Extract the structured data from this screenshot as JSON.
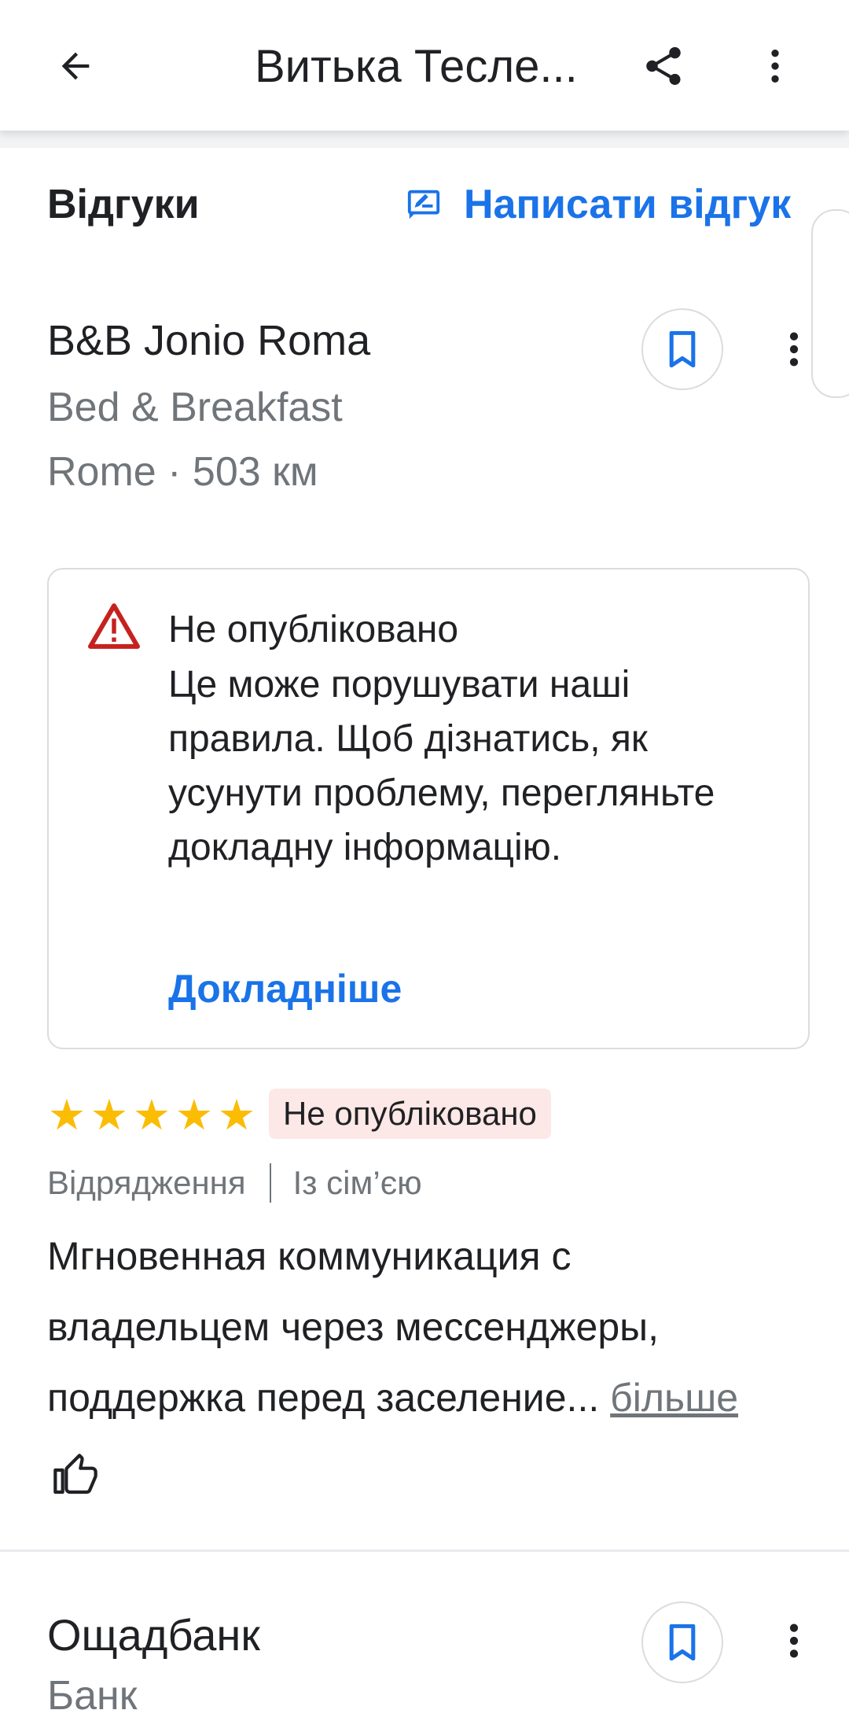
{
  "appbar": {
    "title": "Витька Теслe..."
  },
  "section": {
    "title": "Відгуки",
    "write_review_label": "Написати відгук"
  },
  "review": {
    "place_name": "B&B Jonio Roma",
    "place_type": "Bed & Breakfast",
    "place_location": "Rome · 503 км",
    "warning": {
      "title": "Не опубліковано",
      "body": "Це може порушувати наші правила. Щоб дізнатись, як усунути проблему, перегляньте докладну інформацію.",
      "link_label": "Докладніше"
    },
    "rating": 5,
    "stars": [
      "★",
      "★",
      "★",
      "★",
      "★"
    ],
    "status_label": "Не опубліковано",
    "tags": [
      "Відрядження",
      "Із сім’єю"
    ],
    "text_lines": [
      "Мгновенная коммуникация с",
      "владельцем через мессенджеры,",
      "поддержка перед заселение..."
    ],
    "more_label": "більше"
  },
  "next_review": {
    "place_name": "Ощадбанк",
    "place_type": "Банк"
  },
  "colors": {
    "accent": "#1a73e8",
    "star": "#fbbc04",
    "warning_icon": "#c5221f",
    "status_pill_bg": "#fce8e6"
  },
  "icons": {
    "back": "arrow-back-icon",
    "share": "share-icon",
    "more": "more-vert-icon",
    "write": "rate-review-icon",
    "save": "bookmark-icon",
    "warning": "warning-icon",
    "like": "thumb-up-icon"
  }
}
